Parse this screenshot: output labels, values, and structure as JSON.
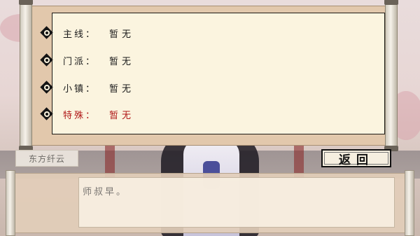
{
  "quest_log": {
    "rows": [
      {
        "label": "主线：",
        "value": "暂无",
        "icon": "quest-diamond-icon"
      },
      {
        "label": "门派：",
        "value": "暂无",
        "icon": "quest-diamond-icon"
      },
      {
        "label": "小镇：",
        "value": "暂无",
        "icon": "quest-diamond-icon"
      },
      {
        "label": "特殊：",
        "value": "暂无",
        "icon": "quest-diamond-icon",
        "color": "#b01818"
      }
    ]
  },
  "buttons": {
    "back_label": "返回"
  },
  "dialog": {
    "speaker": "东方纤云",
    "text": "师叔早。"
  }
}
